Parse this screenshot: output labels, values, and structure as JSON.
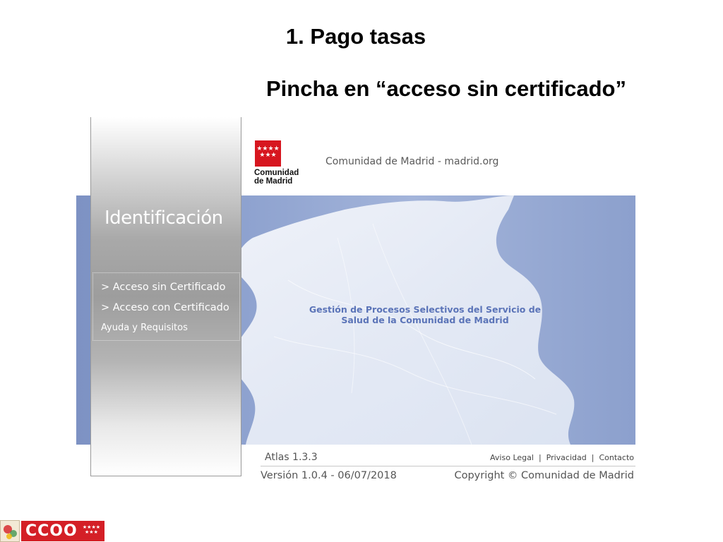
{
  "slide": {
    "title": "1. Pago tasas",
    "subtitle": "Pincha en “acceso sin certificado”"
  },
  "header": {
    "logo_line1": "Comunidad",
    "logo_line2": "de Madrid",
    "site_name": "Comunidad de Madrid - madrid.org",
    "logo_icon": "madrid-flag-stars-icon"
  },
  "sidebar": {
    "title": "Identificación",
    "items": [
      {
        "label": "> Acceso sin Certificado"
      },
      {
        "label": "> Acceso con Certificado"
      },
      {
        "label": "Ayuda y Requisitos"
      }
    ]
  },
  "banner": {
    "text_line1": "Gestión de Procesos Selectivos del Servicio de",
    "text_line2": "Salud de la Comunidad de Madrid"
  },
  "footer": {
    "atlas": "Atlas 1.3.3",
    "version": "Versión 1.0.4 - 06/07/2018",
    "links": [
      "Aviso Legal",
      "Privacidad",
      "Contacto"
    ],
    "copyright": "Copyright © Comunidad de Madrid"
  },
  "brand": {
    "ccoo": "CCOO",
    "icons": [
      "ccoo-emblem-icon",
      "madrid-stars-icon"
    ]
  },
  "colors": {
    "madrid_red": "#d7161f",
    "banner_blue": "#8ea2cf",
    "banner_text": "#5b74b8",
    "ccoo_red": "#d41f26"
  }
}
